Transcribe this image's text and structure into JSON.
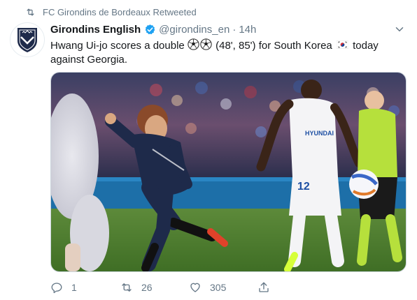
{
  "retweet": {
    "icon": "retweet-icon",
    "text": "FC Girondins de Bordeaux Retweeted"
  },
  "author": {
    "name": "Girondins English",
    "handle": "@girondins_en",
    "separator": "·",
    "time": "14h",
    "verified_icon": "verified-badge-icon",
    "avatar_icon": "bordeaux-crest-icon"
  },
  "tweet": {
    "text_part1": "Hwang Ui-jo scores a double",
    "text_part2": "(48', 85') for South Korea",
    "text_part3": "today against Georgia."
  },
  "media": {
    "kind": "photo",
    "shirt_number": "12",
    "sponsor": "HYUNDAI"
  },
  "actions": {
    "reply_count": "1",
    "retweet_count": "26",
    "like_count": "305"
  },
  "colors": {
    "secondary_text": "#657786",
    "verified_blue": "#1da1f2",
    "bordeaux_navy": "#1e2a4a",
    "lyon_white": "#f4f4f6"
  }
}
